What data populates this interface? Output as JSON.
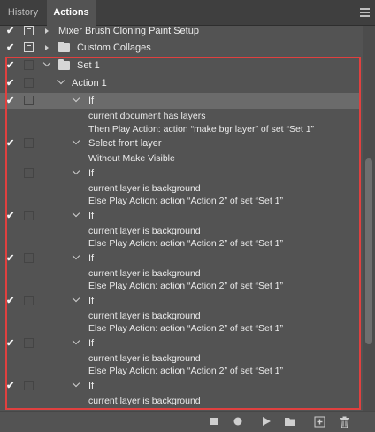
{
  "tabs": {
    "history": "History",
    "actions": "Actions"
  },
  "rows": {
    "mixer": "Mixer Brush Cloning Paint Setup",
    "collages": "Custom Collages",
    "set1": "Set 1",
    "action1": "Action 1",
    "if1": "If",
    "if1_cond": "current document has layers",
    "if1_then": "Then Play Action: action “make bgr layer” of set “Set 1”",
    "select": "Select front layer",
    "select_opt": "Without Make Visible",
    "if2": "If",
    "if2_cond": "current layer is background",
    "if2_else": "Else Play Action: action “Action 2” of set “Set 1”",
    "if3": "If",
    "if3_cond": "current layer is background",
    "if3_else": "Else Play Action: action “Action 2” of set “Set 1”",
    "if4": "If",
    "if4_cond": "current layer is background",
    "if4_else": "Else Play Action: action “Action 2” of set “Set 1”",
    "if5": "If",
    "if5_cond": "current layer is background",
    "if5_else": "Else Play Action: action “Action 2” of set “Set 1”",
    "if6": "If",
    "if6_cond": "current layer is background",
    "if6_else": "Else Play Action: action “Action 2” of set “Set 1”",
    "if7": "If",
    "if7_cond": "current layer is background"
  },
  "icons": {
    "check": "✔",
    "stop": "stop-icon",
    "record": "record-icon",
    "play": "play-icon",
    "new_set": "folder-icon",
    "new_action": "new-action-icon",
    "delete": "trash-icon"
  },
  "colors": {
    "highlight_border": "#e0403f",
    "panel_bg": "#535353",
    "selected_row": "#6b6b6b"
  }
}
